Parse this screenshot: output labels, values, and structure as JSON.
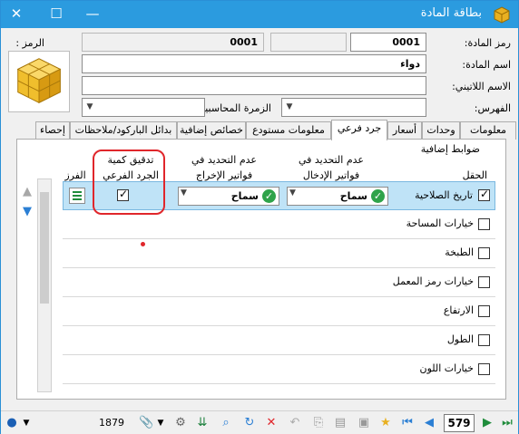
{
  "window": {
    "title": "بطاقة المادة",
    "minimize": "—",
    "maximize": "☐",
    "close": "✕"
  },
  "form": {
    "code_label": "الرمز :",
    "material_code_label": "رمز المادة:",
    "material_code_value": "0001",
    "code_value": "0001",
    "material_name_label": "اسم المادة:",
    "material_name_value": "دواء",
    "latin_name_label": "الاسم اللاتيني:",
    "index_label": "الفهرس:",
    "account_group_label": "الزمرة المحاسبية:"
  },
  "tabs": [
    {
      "label": "معلومات"
    },
    {
      "label": "وحدات"
    },
    {
      "label": "أسعار"
    },
    {
      "label": "جرد فرعي"
    },
    {
      "label": "معلومات مستودع"
    },
    {
      "label": "خصائص إضافية"
    },
    {
      "label": "بدائل الباركود/ملاحظات"
    },
    {
      "label": "إحصاء"
    }
  ],
  "panel": {
    "section_title": "ضوابط إضافية",
    "headers": {
      "field": "الحقل",
      "no_update_in_1": "عدم التحديد في",
      "no_update_in_2": "فواتير الإدخال",
      "no_update_out_1": "عدم التحديد في",
      "no_update_out_2": "فواتير الإخراج",
      "audit_1": "تدقيق كمية",
      "audit_2": "الجرد الفرعي",
      "sort": "الفرز"
    },
    "rows": [
      {
        "name": "تاريخ الصلاحية",
        "checked": true,
        "in_value": "سماح",
        "out_value": "سماح",
        "audit": true
      },
      {
        "name": "خيارات المساحة",
        "checked": false
      },
      {
        "name": "الطبخة",
        "checked": false
      },
      {
        "name": "خيارات رمز المعمل",
        "checked": false
      },
      {
        "name": "الارتفاع",
        "checked": false
      },
      {
        "name": "الطول",
        "checked": false
      },
      {
        "name": "خيارات اللون",
        "checked": false
      }
    ]
  },
  "status": {
    "record_count": "1879",
    "current_record": "579"
  },
  "colors": {
    "titlebar": "#2b9bdf",
    "accent": "#e0262b",
    "ok": "#2fa34a"
  }
}
